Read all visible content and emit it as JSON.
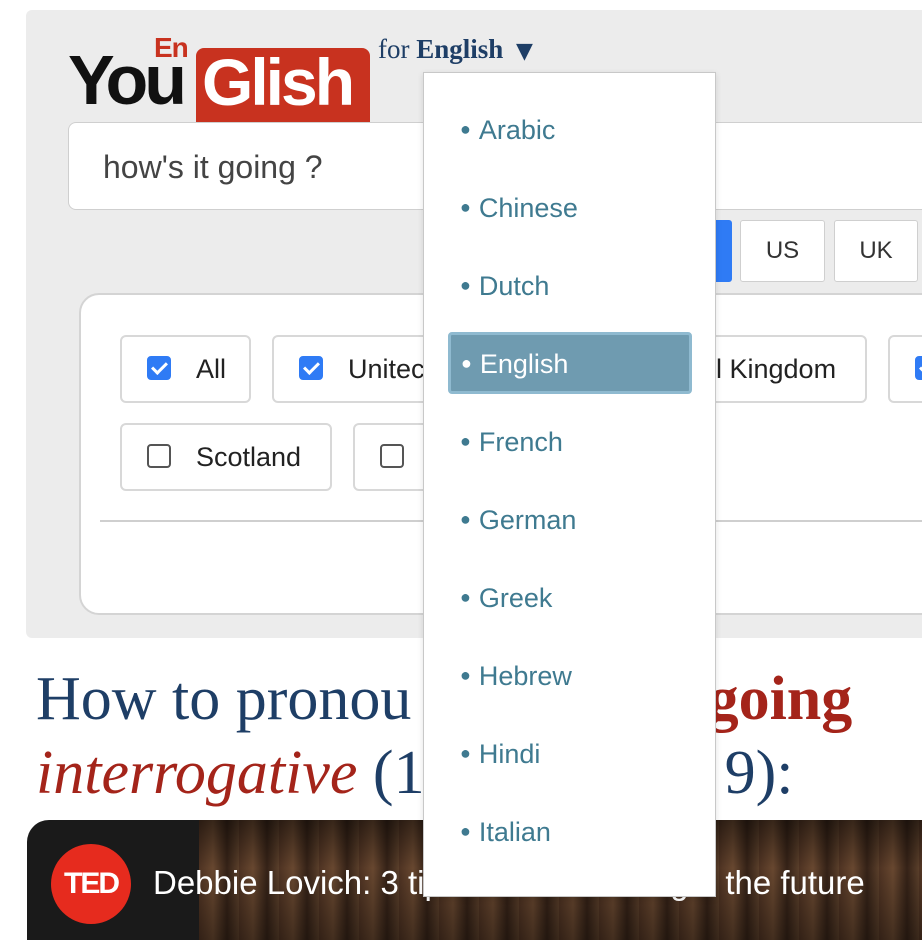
{
  "logo": {
    "en": "En",
    "you": "You",
    "glish": "Glish"
  },
  "language_selector": {
    "prefix": "for",
    "language": "English",
    "caret": "▼"
  },
  "search": {
    "value": "how's it going ?"
  },
  "accents": {
    "us": "US",
    "uk": "UK"
  },
  "filters": {
    "all": "All",
    "united": "Unitec",
    "kingdom": "l Kingdom",
    "scotland": "Scotland"
  },
  "dropdown": {
    "items": [
      "Arabic",
      "Chinese",
      "Dutch",
      "English",
      "French",
      "German",
      "Greek",
      "Hebrew",
      "Hindi",
      "Italian"
    ],
    "selected": "English"
  },
  "heading": {
    "part1": "How to pronou",
    "part2": "t going",
    "part3": "interrogative",
    "part4": " (1",
    "part5": "9):"
  },
  "video": {
    "channel_logo": "TED",
    "title": "Debbie Lovich: 3 tips for leaders to get the future"
  },
  "colors": {
    "brand_red": "#c8321f",
    "selected_item": "#6f9bb0",
    "checkbox_blue": "#2f7bf5"
  }
}
